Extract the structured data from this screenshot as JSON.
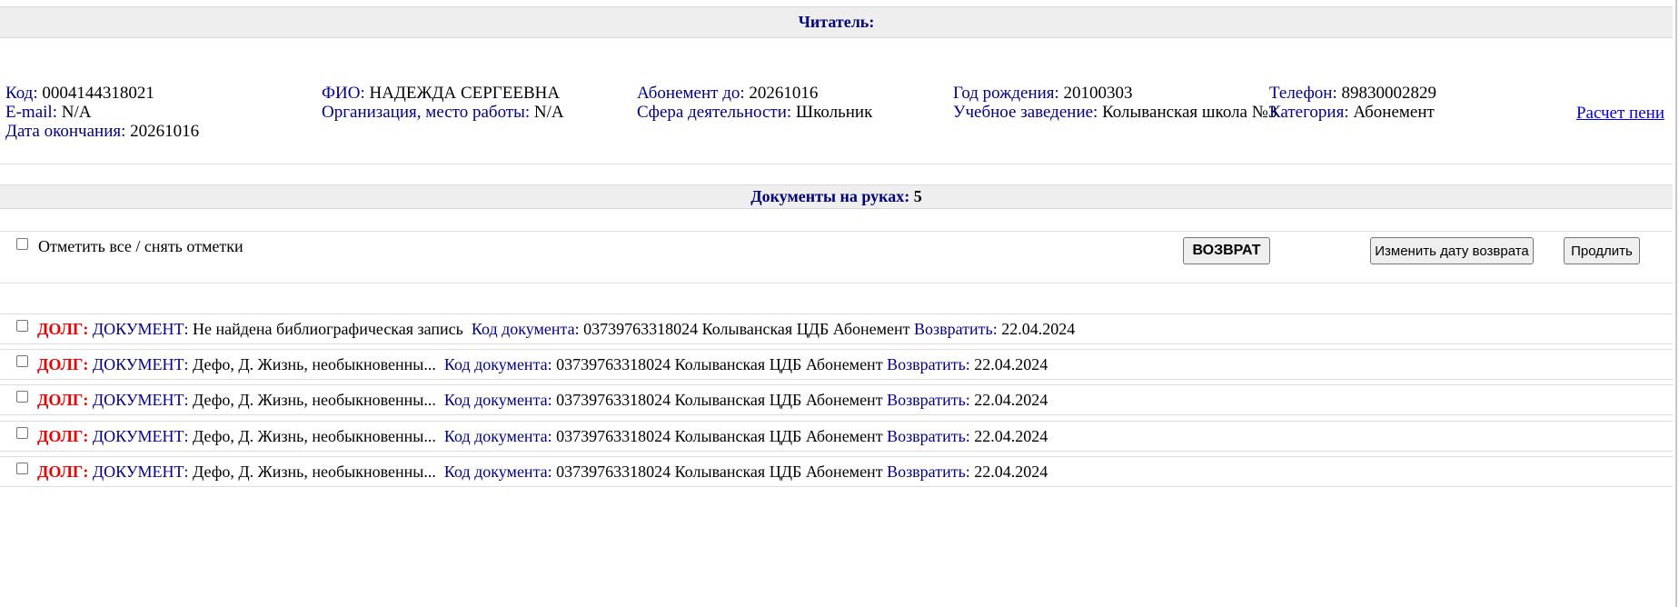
{
  "header": {
    "title": "Читатель:"
  },
  "reader": {
    "code_label": "Код:",
    "code": "0004144318021",
    "email_label": "E-mail:",
    "email": "N/A",
    "end_date_label": "Дата окончания:",
    "end_date": "20261016",
    "name_label": "ФИО:",
    "name": "НАДЕЖДА СЕРГЕЕВНА",
    "org_label": "Организация, место работы:",
    "org": "N/A",
    "subscription_label": "Абонемент до:",
    "subscription": "20261016",
    "sphere_label": "Сфера деятельности:",
    "sphere": "Школьник",
    "birth_label": "Год рождения:",
    "birth": "20100303",
    "school_label": "Учебное заведение:",
    "school": "Колыванская школа №3",
    "phone_label": "Телефон:",
    "phone": "89830002829",
    "category_label": "Категория:",
    "category": "Абонемент",
    "penalty_link": "Расчет пени"
  },
  "documents_header": {
    "label": "Документы на руках:",
    "count": "5"
  },
  "toolbar": {
    "select_all_label": "Отметить все / снять отметки",
    "return_button": "ВОЗВРАТ",
    "change_date_button": "Изменить дату возврата",
    "extend_button": "Продлить"
  },
  "loans": [
    {
      "debt": "ДОЛГ:",
      "doc_label": "ДОКУМЕНТ:",
      "title": "Не найдена библиографическая запись",
      "code_label": "Код документа:",
      "code": "03739763318024",
      "location": "Колыванская ЦДБ Абонемент",
      "return_label": "Возвратить:",
      "return_date": "22.04.2024"
    },
    {
      "debt": "ДОЛГ:",
      "doc_label": "ДОКУМЕНТ:",
      "title": "Дефо, Д. Жизнь, необыкновенны...",
      "code_label": "Код документа:",
      "code": "03739763318024",
      "location": "Колыванская ЦДБ Абонемент",
      "return_label": "Возвратить:",
      "return_date": "22.04.2024"
    },
    {
      "debt": "ДОЛГ:",
      "doc_label": "ДОКУМЕНТ:",
      "title": "Дефо, Д. Жизнь, необыкновенны...",
      "code_label": "Код документа:",
      "code": "03739763318024",
      "location": "Колыванская ЦДБ Абонемент",
      "return_label": "Возвратить:",
      "return_date": "22.04.2024"
    },
    {
      "debt": "ДОЛГ:",
      "doc_label": "ДОКУМЕНТ:",
      "title": "Дефо, Д. Жизнь, необыкновенны...",
      "code_label": "Код документа:",
      "code": "03739763318024",
      "location": "Колыванская ЦДБ Абонемент",
      "return_label": "Возвратить:",
      "return_date": "22.04.2024"
    },
    {
      "debt": "ДОЛГ:",
      "doc_label": "ДОКУМЕНТ:",
      "title": "Дефо, Д. Жизнь, необыкновенны...",
      "code_label": "Код документа:",
      "code": "03739763318024",
      "location": "Колыванская ЦДБ Абонемент",
      "return_label": "Возвратить:",
      "return_date": "22.04.2024"
    }
  ]
}
